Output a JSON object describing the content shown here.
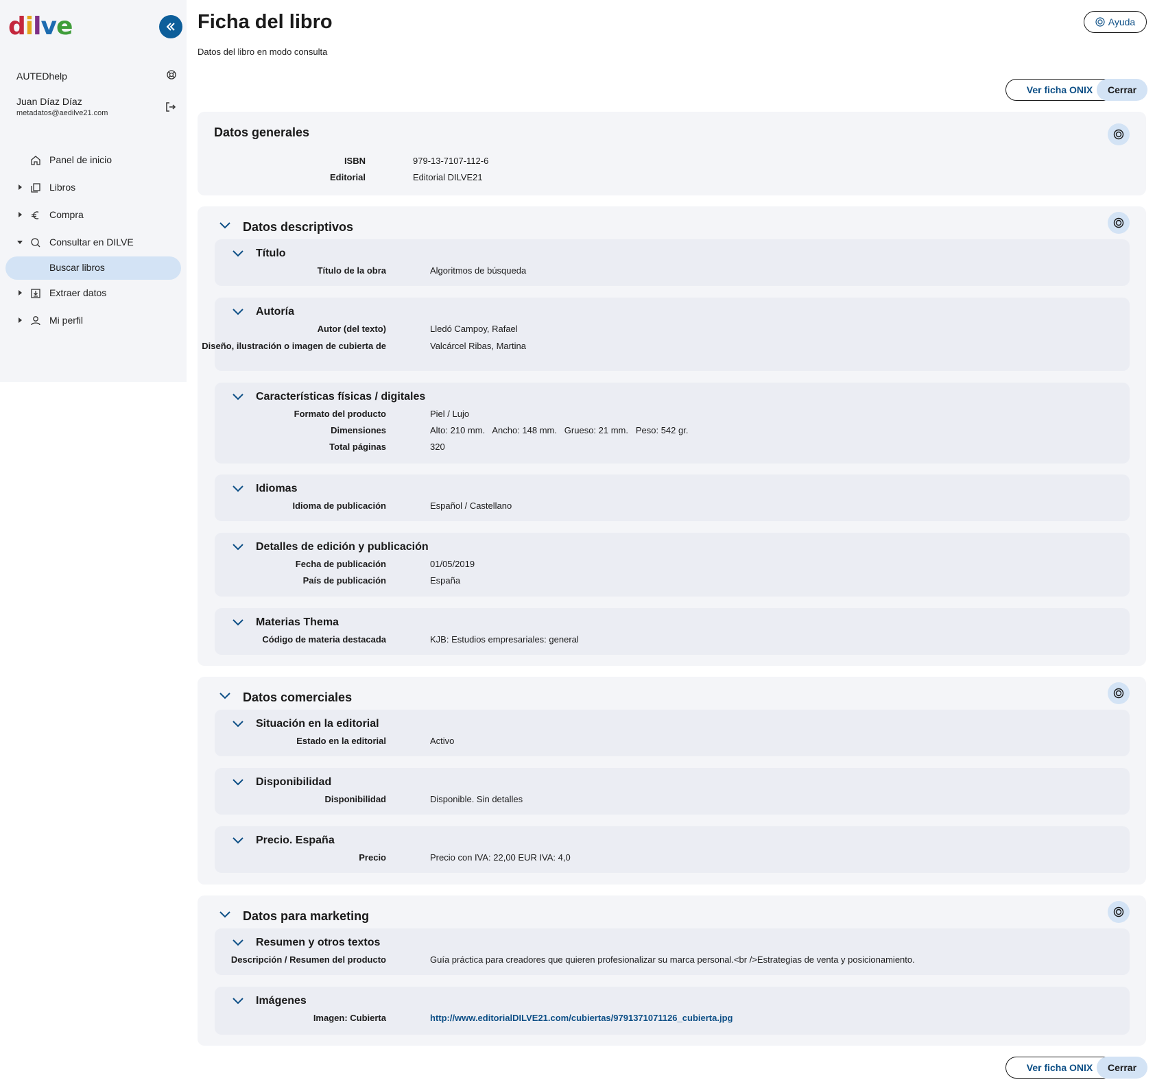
{
  "sidebar": {
    "logo": {
      "d": "d",
      "i": "i",
      "l": "l",
      "v": "v",
      "e": "e"
    },
    "org": "AUTEDhelp",
    "user_name": "Juan Díaz Díaz",
    "user_email": "metadatos@aedilve21.com",
    "nav": [
      {
        "label": "Panel de inicio"
      },
      {
        "label": "Libros"
      },
      {
        "label": "Compra"
      },
      {
        "label": "Consultar en DILVE"
      },
      {
        "label": "Buscar libros"
      },
      {
        "label": "Extraer datos"
      },
      {
        "label": "Mi perfil"
      }
    ]
  },
  "header": {
    "title": "Ficha del libro",
    "subtitle": "Datos del libro en modo consulta",
    "help_label": "Ayuda",
    "onix_label": "Ver ficha ONIX",
    "close_label": "Cerrar"
  },
  "general": {
    "title": "Datos generales",
    "isbn_label": "ISBN",
    "isbn": "979-13-7107-112-6",
    "editorial_label": "Editorial",
    "editorial": "Editorial DILVE21"
  },
  "descriptive": {
    "title": "Datos descriptivos",
    "titulo": {
      "title": "Título",
      "k1": "Título de la obra",
      "v1": "Algoritmos de búsqueda"
    },
    "autoria": {
      "title": "Autoría",
      "k1": "Autor (del texto)",
      "v1": "Lledó Campoy, Rafael",
      "k2": "Diseño, ilustración o imagen de cubierta de",
      "v2": "Valcárcel Ribas, Martina"
    },
    "fisicas": {
      "title": "Características físicas / digitales",
      "k1": "Formato del producto",
      "v1": "Piel / Lujo",
      "k2": "Dimensiones",
      "v2": "Alto: 210 mm.   Ancho: 148 mm.   Grueso: 21 mm.   Peso: 542 gr.",
      "k3": "Total páginas",
      "v3": "320"
    },
    "idiomas": {
      "title": "Idiomas",
      "k1": "Idioma de publicación",
      "v1": "Español / Castellano"
    },
    "edicion": {
      "title": "Detalles de edición y publicación",
      "k1": "Fecha de publicación",
      "v1": "01/05/2019",
      "k2": "País de publicación",
      "v2": "España"
    },
    "materias": {
      "title": "Materias Thema",
      "k1": "Código de materia destacada",
      "v1": "KJB: Estudios empresariales: general"
    }
  },
  "commercial": {
    "title": "Datos comerciales",
    "situacion": {
      "title": "Situación en la editorial",
      "k1": "Estado en la editorial",
      "v1": "Activo"
    },
    "disponibilidad": {
      "title": "Disponibilidad",
      "k1": "Disponibilidad",
      "v1": "Disponible. Sin detalles"
    },
    "precio": {
      "title": "Precio. España",
      "k1": "Precio",
      "v1": "Precio con IVA: 22,00 EUR IVA: 4,0"
    }
  },
  "marketing": {
    "title": "Datos para marketing",
    "resumen": {
      "title": "Resumen y otros textos",
      "k1": "Descripción / Resumen del producto",
      "v1": "Guía práctica para creadores que quieren profesionalizar su marca personal.<br />Estrategias de venta y posicionamiento."
    },
    "imagenes": {
      "title": "Imágenes",
      "k1": "Imagen: Cubierta",
      "v1": "http://www.editorialDILVE21.com/cubiertas/9791371071126_cubierta.jpg"
    }
  }
}
